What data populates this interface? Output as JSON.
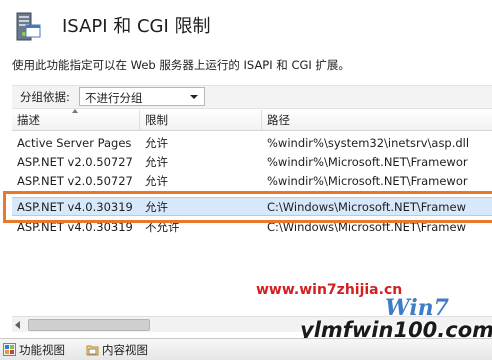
{
  "header": {
    "title": "ISAPI 和 CGI 限制",
    "description": "使用此功能指定可以在 Web 服务器上运行的 ISAPI 和 CGI 扩展。"
  },
  "group_by": {
    "label": "分组依据:",
    "selected": "不进行分组"
  },
  "table": {
    "columns": [
      "描述",
      "限制",
      "路径"
    ],
    "rows": [
      {
        "desc": "Active Server Pages",
        "restriction": "允许",
        "path": "%windir%\\system32\\inetsrv\\asp.dll"
      },
      {
        "desc": "ASP.NET v2.0.50727",
        "restriction": "允许",
        "path": "%windir%\\Microsoft.NET\\Framewor"
      },
      {
        "desc": "ASP.NET v2.0.50727",
        "restriction": "允许",
        "path": "%windir%\\Microsoft.NET\\Framewor"
      },
      {
        "desc": "ASP.NET v4.0.30319",
        "restriction": "允许",
        "path": "C:\\Windows\\Microsoft.NET\\Framew"
      },
      {
        "desc": "ASP.NET v4.0.30319",
        "restriction": "不允许",
        "path": "C:\\Windows\\Microsoft.NET\\Framew"
      }
    ],
    "selected_row": 3
  },
  "bottom_tabs": {
    "features_view": "功能视图",
    "content_view": "内容视图"
  },
  "watermarks": {
    "site1": "www.win7zhijia.cn",
    "logo": "Win7",
    "site2": "ylmfwin100.com"
  },
  "colors": {
    "highlight_border": "#e8792a",
    "selected_row": "#d8e8fb",
    "watermark_red": "#d42020"
  }
}
